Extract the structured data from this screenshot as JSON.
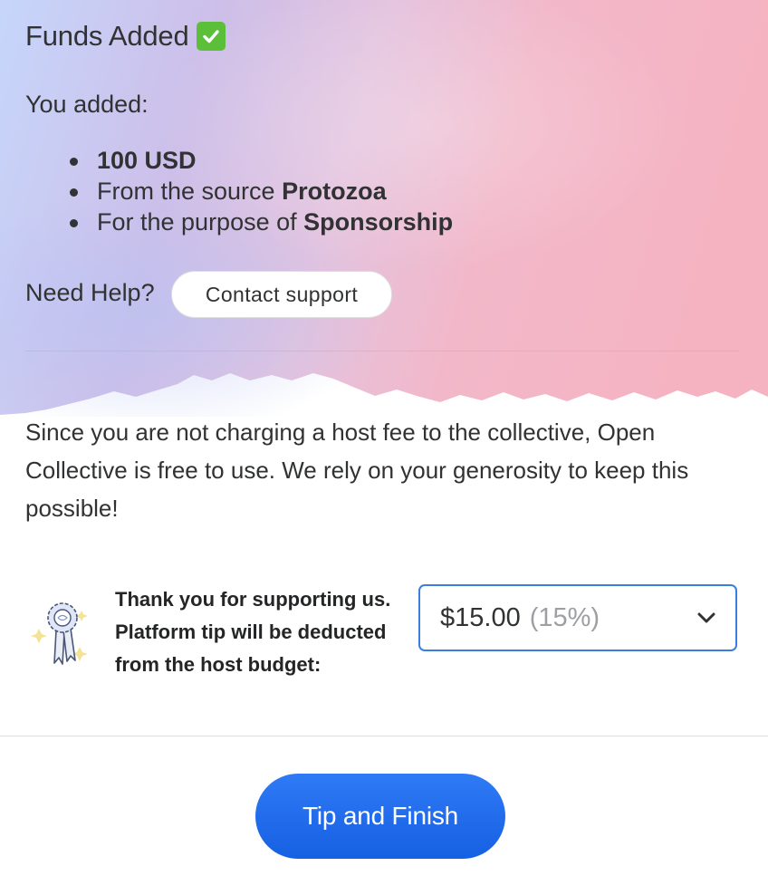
{
  "header": {
    "title": "Funds Added",
    "title_icon": "check-mark-button-emoji"
  },
  "summary": {
    "intro": "You added:",
    "items": [
      {
        "prefix": "",
        "value": "100 USD"
      },
      {
        "prefix": "From the source ",
        "value": "Protozoa"
      },
      {
        "prefix": "For the purpose of ",
        "value": "Sponsorship"
      }
    ]
  },
  "help": {
    "label": "Need Help?",
    "button_label": "Contact support"
  },
  "notice": "Since you are not charging a host fee to the collective, Open Collective is free to use. We rely on your generosity to keep this possible!",
  "tip": {
    "message": "Thank you for supporting us. Platform tip will be deducted from the host budget:",
    "selected_amount": "$15.00",
    "selected_percent": "(15%)",
    "icon": "award-ribbon-icon"
  },
  "footer": {
    "finish_label": "Tip and Finish"
  },
  "colors": {
    "accent": "#1869f5",
    "select_border": "#3b7de3",
    "check_green": "#5bbf3a",
    "watercolor_left": "#c5d3f7",
    "watercolor_right": "#f4b6c4"
  }
}
